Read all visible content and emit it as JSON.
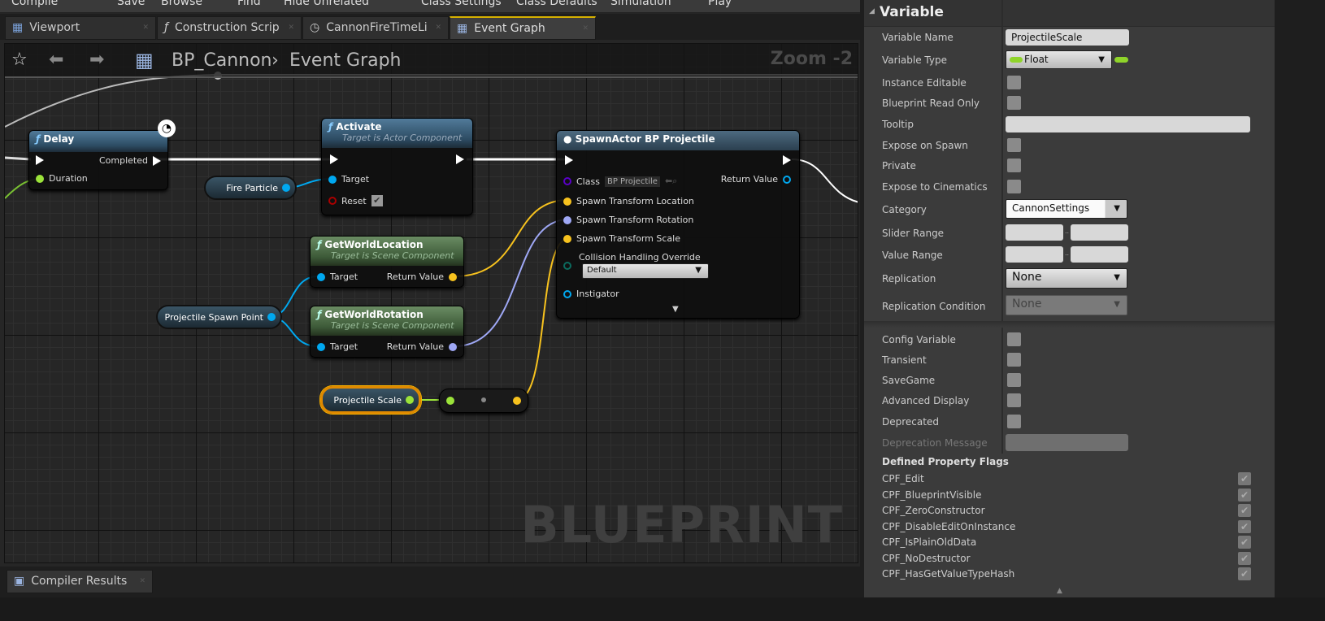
{
  "toolbar": {
    "items": [
      "Compile",
      "Save",
      "Browse",
      "Find",
      "Hide Unrelated",
      "Class Settings",
      "Class Defaults",
      "Simulation",
      "Play"
    ]
  },
  "tabs": [
    {
      "label": "Viewport",
      "icon": "viewport-icon"
    },
    {
      "label": "Construction Scrip",
      "icon": "function-icon"
    },
    {
      "label": "CannonFireTimeLi",
      "icon": "clock-icon"
    },
    {
      "label": "Event Graph",
      "icon": "graph-icon",
      "active": true
    }
  ],
  "breadcrumb": {
    "blueprint": "BP_Cannon",
    "separator": "›",
    "graph": "Event Graph"
  },
  "graph": {
    "zoom": "Zoom -2",
    "watermark": "BLUEPRINT",
    "nodes": {
      "delay": {
        "title": "Delay",
        "completed": "Completed",
        "duration": "Duration"
      },
      "activate": {
        "title": "Activate",
        "subtitle": "Target is Actor Component",
        "target": "Target",
        "reset": "Reset"
      },
      "fire_particle": {
        "label": "Fire Particle"
      },
      "get_world_location": {
        "title": "GetWorldLocation",
        "subtitle": "Target is Scene Component",
        "target": "Target",
        "return": "Return Value"
      },
      "get_world_rotation": {
        "title": "GetWorldRotation",
        "subtitle": "Target is Scene Component",
        "target": "Target",
        "return": "Return Value"
      },
      "spawn_point": {
        "label": "Projectile Spawn Point"
      },
      "projectile_scale": {
        "label": "Projectile Scale"
      },
      "spawn_actor": {
        "title": "SpawnActor BP Projectile",
        "class": "Class",
        "class_value": "BP Projectile",
        "return": "Return Value",
        "loc": "Spawn Transform Location",
        "rot": "Spawn Transform Rotation",
        "scale": "Spawn Transform Scale",
        "collision": "Collision Handling Override",
        "collision_value": "Default",
        "instigator": "Instigator"
      }
    }
  },
  "bottom_tab": {
    "label": "Compiler Results"
  },
  "details": {
    "section": "Variable",
    "variable_name": {
      "label": "Variable Name",
      "value": "ProjectileScale"
    },
    "variable_type": {
      "label": "Variable Type",
      "value": "Float"
    },
    "instance_editable": "Instance Editable",
    "blueprint_read_only": "Blueprint Read Only",
    "tooltip": "Tooltip",
    "expose_on_spawn": "Expose on Spawn",
    "private": "Private",
    "expose_to_cinematics": "Expose to Cinematics",
    "category": {
      "label": "Category",
      "value": "CannonSettings"
    },
    "slider_range": "Slider Range",
    "value_range": "Value Range",
    "range_sep": "..",
    "replication": {
      "label": "Replication",
      "value": "None"
    },
    "replication_condition": {
      "label": "Replication Condition",
      "value": "None"
    },
    "config_variable": "Config Variable",
    "transient": "Transient",
    "savegame": "SaveGame",
    "advanced_display": "Advanced Display",
    "deprecated": "Deprecated",
    "deprecation_message": "Deprecation Message",
    "flags_header": "Defined Property Flags",
    "flags": [
      "CPF_Edit",
      "CPF_BlueprintVisible",
      "CPF_ZeroConstructor",
      "CPF_DisableEditOnInstance",
      "CPF_IsPlainOldData",
      "CPF_NoDestructor",
      "CPF_HasGetValueTypeHash"
    ]
  },
  "colors": {
    "exec": "#ffffff",
    "float": "#9be33a",
    "object": "#00a8f0",
    "vector": "#f7c21e",
    "rotator": "#9fa8f5",
    "class": "#5a00c8",
    "accent": "#d6b000"
  }
}
